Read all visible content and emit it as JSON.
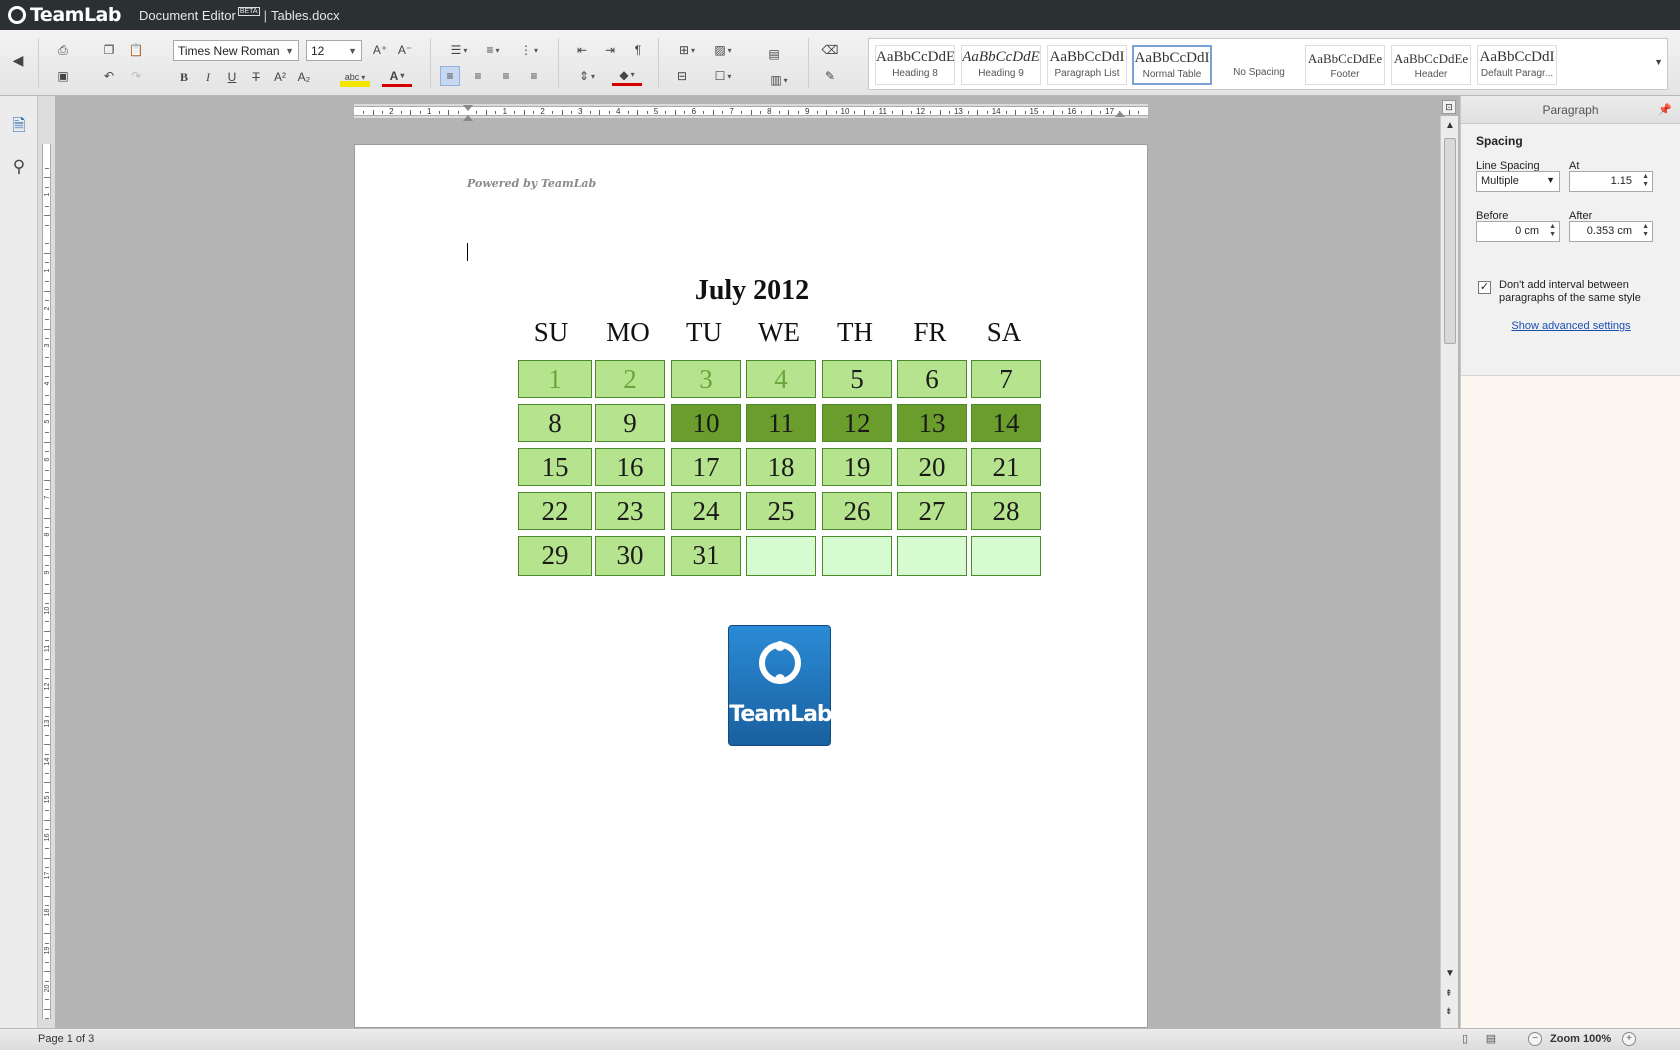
{
  "titlebar": {
    "brand": "TeamLab",
    "app": "Document Editor",
    "beta": "BETA",
    "separator": "|",
    "file": "Tables.docx"
  },
  "toolbar": {
    "font_name": "Times New Roman",
    "font_size": "12"
  },
  "styles": [
    {
      "sample": "AaBbCcDdE",
      "name": "Heading 8",
      "italic": false
    },
    {
      "sample": "AaBbCcDdE",
      "name": "Heading 9",
      "italic": true
    },
    {
      "sample": "AaBbCcDdI",
      "name": "Paragraph List",
      "italic": false
    },
    {
      "sample": "AaBbCcDdI",
      "name": "Normal Table",
      "italic": false,
      "active": true
    },
    {
      "sample": "",
      "name": "No Spacing",
      "italic": false
    },
    {
      "sample": "AaBbCcDdEe",
      "name": "Footer",
      "italic": false
    },
    {
      "sample": "AaBbCcDdEe",
      "name": "Header",
      "italic": false
    },
    {
      "sample": "AaBbCcDdI",
      "name": "Default Paragr...",
      "italic": false
    }
  ],
  "document": {
    "powered_by": "Powered by TeamLab",
    "calendar": {
      "title": "July 2012",
      "weekdays": [
        "SU",
        "MO",
        "TU",
        "WE",
        "TH",
        "FR",
        "SA"
      ],
      "weeks": [
        [
          {
            "d": "1",
            "s": "light"
          },
          {
            "d": "2",
            "s": "light"
          },
          {
            "d": "3",
            "s": "light"
          },
          {
            "d": "4",
            "s": "light"
          },
          {
            "d": "5",
            "s": "normal"
          },
          {
            "d": "6",
            "s": "normal"
          },
          {
            "d": "7",
            "s": "normal"
          }
        ],
        [
          {
            "d": "8",
            "s": "normal"
          },
          {
            "d": "9",
            "s": "normal"
          },
          {
            "d": "10",
            "s": "dark"
          },
          {
            "d": "11",
            "s": "dark"
          },
          {
            "d": "12",
            "s": "dark"
          },
          {
            "d": "13",
            "s": "dark"
          },
          {
            "d": "14",
            "s": "dark"
          }
        ],
        [
          {
            "d": "15",
            "s": "normal"
          },
          {
            "d": "16",
            "s": "normal"
          },
          {
            "d": "17",
            "s": "normal"
          },
          {
            "d": "18",
            "s": "normal"
          },
          {
            "d": "19",
            "s": "normal"
          },
          {
            "d": "20",
            "s": "normal"
          },
          {
            "d": "21",
            "s": "normal"
          }
        ],
        [
          {
            "d": "22",
            "s": "normal"
          },
          {
            "d": "23",
            "s": "normal"
          },
          {
            "d": "24",
            "s": "normal"
          },
          {
            "d": "25",
            "s": "normal"
          },
          {
            "d": "26",
            "s": "normal"
          },
          {
            "d": "27",
            "s": "normal"
          },
          {
            "d": "28",
            "s": "normal"
          }
        ],
        [
          {
            "d": "29",
            "s": "normal"
          },
          {
            "d": "30",
            "s": "normal"
          },
          {
            "d": "31",
            "s": "normal"
          },
          {
            "d": "",
            "s": "empty"
          },
          {
            "d": "",
            "s": "empty"
          },
          {
            "d": "",
            "s": "empty"
          },
          {
            "d": "",
            "s": "empty"
          }
        ]
      ]
    },
    "logo_text": "TeamLab"
  },
  "rulers": {
    "horizontal_numbers": [
      "2",
      "1",
      "1",
      "2",
      "3",
      "4",
      "5",
      "6",
      "7",
      "8",
      "9",
      "10",
      "11",
      "12",
      "13",
      "14",
      "15",
      "16",
      "17"
    ],
    "vertical_numbers": [
      "1",
      "1",
      "2",
      "3",
      "4",
      "5",
      "6",
      "7",
      "8",
      "9",
      "10",
      "11",
      "12",
      "13",
      "14",
      "15",
      "16",
      "17",
      "18",
      "19",
      "20",
      "21"
    ]
  },
  "panel": {
    "title": "Paragraph",
    "section": "Spacing",
    "line_spacing_label": "Line Spacing",
    "line_spacing_value": "Multiple",
    "at_label": "At",
    "at_value": "1.15",
    "before_label": "Before",
    "before_value": "0 cm",
    "after_label": "After",
    "after_value": "0.353 cm",
    "checkbox_label": "Don't add interval between paragraphs of the same style",
    "checkbox_checked": true,
    "advanced_link": "Show advanced settings"
  },
  "statusbar": {
    "page_info": "Page 1 of 3",
    "zoom": "Zoom 100%"
  },
  "colors": {
    "calendar_light": "#b6e48e",
    "calendar_dark": "#6a9d2c",
    "calendar_empty": "#d7fbd1",
    "accent": "#1e64b4"
  }
}
